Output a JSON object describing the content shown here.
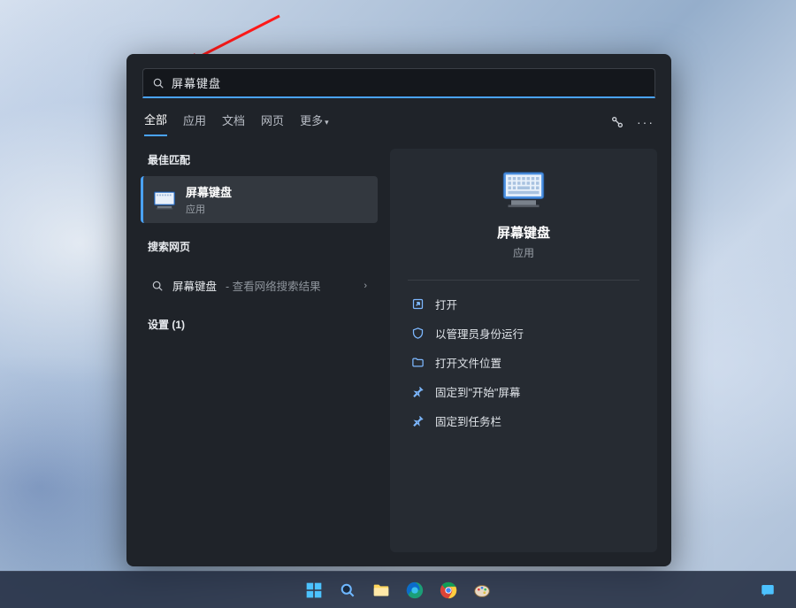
{
  "search": {
    "value": "屏幕键盘"
  },
  "tabs": {
    "all": "全部",
    "apps": "应用",
    "docs": "文档",
    "web": "网页",
    "more": "更多"
  },
  "left": {
    "best_match_label": "最佳匹配",
    "best_match": {
      "title": "屏幕键盘",
      "subtitle": "应用"
    },
    "search_web_label": "搜索网页",
    "web_item": {
      "term": "屏幕键盘",
      "suffix": " - 查看网络搜索结果"
    },
    "settings_label": "设置 (1)"
  },
  "detail": {
    "title": "屏幕键盘",
    "subtitle": "应用",
    "actions": {
      "open": "打开",
      "run_admin": "以管理员身份运行",
      "open_location": "打开文件位置",
      "pin_start": "固定到\"开始\"屏幕",
      "pin_taskbar": "固定到任务栏"
    }
  }
}
